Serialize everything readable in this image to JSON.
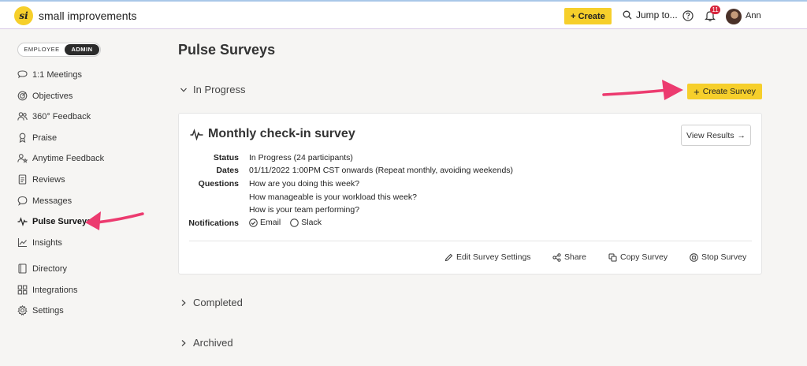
{
  "header": {
    "logo_mark": "si",
    "logo_text": "small improvements",
    "create_label": "Create",
    "jump_label": "Jump to...",
    "notification_count": "11",
    "user_name": "Ann"
  },
  "role_toggle": {
    "employee": "EMPLOYEE",
    "admin": "ADMIN",
    "selected": "ADMIN"
  },
  "sidebar": {
    "items": [
      {
        "label": "1:1 Meetings",
        "icon": "chat-icon"
      },
      {
        "label": "Objectives",
        "icon": "target-icon"
      },
      {
        "label": "360° Feedback",
        "icon": "people-icon"
      },
      {
        "label": "Praise",
        "icon": "ribbon-icon"
      },
      {
        "label": "Anytime Feedback",
        "icon": "person-star-icon"
      },
      {
        "label": "Reviews",
        "icon": "document-icon"
      },
      {
        "label": "Messages",
        "icon": "message-icon"
      },
      {
        "label": "Pulse Surveys",
        "icon": "pulse-icon",
        "active": true
      },
      {
        "label": "Insights",
        "icon": "chart-icon"
      },
      {
        "label": "Directory",
        "icon": "book-icon"
      },
      {
        "label": "Integrations",
        "icon": "grid-icon"
      },
      {
        "label": "Settings",
        "icon": "gear-icon"
      }
    ]
  },
  "main": {
    "title": "Pulse Surveys",
    "sections": {
      "in_progress": "In Progress",
      "completed": "Completed",
      "archived": "Archived"
    },
    "create_survey_label": "Create Survey",
    "survey": {
      "title": "Monthly check-in survey",
      "view_results_label": "View Results",
      "labels": {
        "status": "Status",
        "dates": "Dates",
        "questions": "Questions",
        "notifications": "Notifications"
      },
      "status": "In Progress (24 participants)",
      "dates": "01/11/2022 1:00PM CST onwards (Repeat monthly, avoiding weekends)",
      "questions": [
        "How are you doing this week?",
        "How manageable is your workload this week?",
        "How is your team performing?"
      ],
      "notifications": [
        {
          "label": "Email",
          "checked": true
        },
        {
          "label": "Slack",
          "checked": false
        }
      ],
      "actions": {
        "edit": "Edit Survey Settings",
        "share": "Share",
        "copy": "Copy Survey",
        "stop": "Stop Survey"
      }
    }
  },
  "colors": {
    "accent_yellow": "#f6cf2b",
    "annotation_arrow": "#ec3b6f",
    "badge_red": "#d7263d"
  }
}
